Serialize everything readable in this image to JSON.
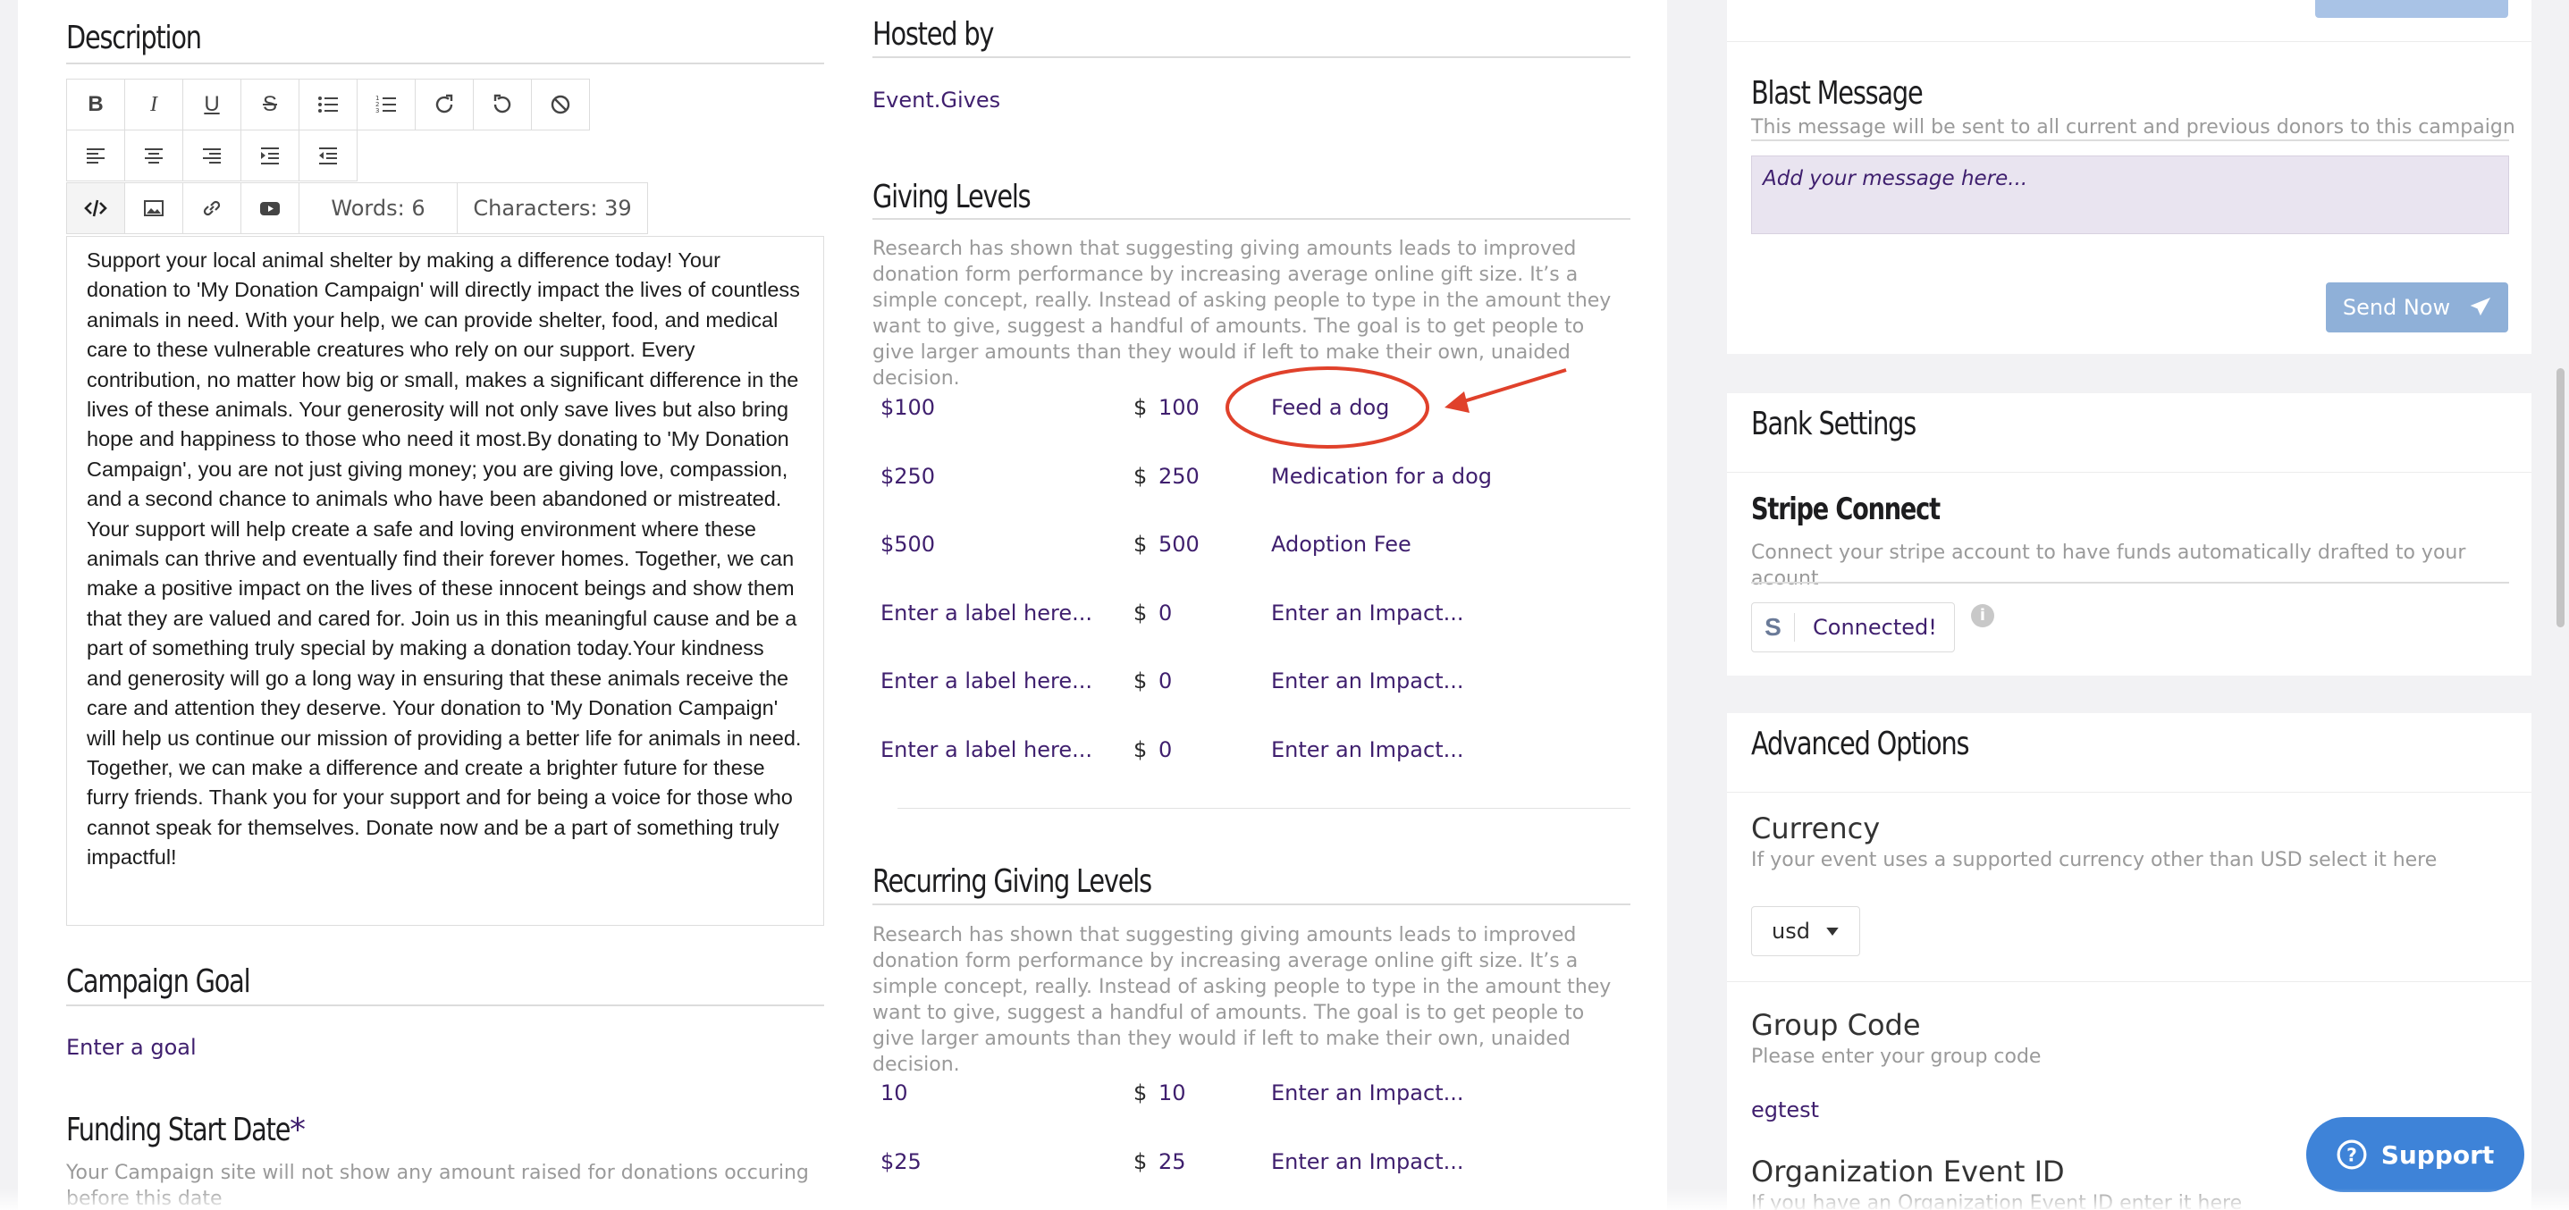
{
  "left": {
    "description_heading": "Description",
    "toolbar": {
      "bold": "B",
      "italic": "I",
      "underline": "U",
      "strike": "S",
      "words": "Words: 6",
      "characters": "Characters: 39"
    },
    "description_text": "Support your local animal shelter by making a difference today! Your donation to 'My Donation Campaign' will directly impact the lives of countless animals in need. With your help, we can provide shelter, food, and medical care to these vulnerable creatures who rely on our support. Every contribution, no matter how big or small, makes a significant difference in the lives of these animals. Your generosity will not only save lives but also bring hope and happiness to those who need it most.By donating to 'My Donation Campaign', you are not just giving money; you are giving love, compassion, and a second chance to animals who have been abandoned or mistreated. Your support will help create a safe and loving environment where these animals can thrive and eventually find their forever homes. Together, we can make a positive impact on the lives of these innocent beings and show them that they are valued and cared for. Join us in this meaningful cause and be a part of something truly special by making a donation today.Your kindness and generosity will go a long way in ensuring that these animals receive the care and attention they deserve. Your donation to 'My Donation Campaign' will help us continue our mission of providing a better life for animals in need. Together, we can make a difference and create a brighter future for these furry friends. Thank you for your support and for being a voice for those who cannot speak for themselves. Donate now and be a part of something truly impactful!",
    "campaign_goal_heading": "Campaign Goal",
    "campaign_goal_placeholder": "Enter a goal",
    "funding_start_heading": "Funding Start Date",
    "funding_start_required": "*",
    "funding_start_help": "Your Campaign site will not show any amount raised for donations occuring before this date"
  },
  "middle": {
    "hosted_by_heading": "Hosted by",
    "hosted_by_value": "Event.Gives",
    "giving_levels_heading": "Giving Levels",
    "giving_levels_help": "Research has shown that suggesting giving amounts leads to improved donation form performance by increasing average online gift size. It’s a simple concept, really. Instead of asking people to type in the amount they want to give, suggest a handful of amounts. The goal is to get people to give larger amounts than they would if left to make their own, unaided decision.",
    "giving_levels": [
      {
        "label": "$100",
        "currency": "$",
        "amount": "100",
        "impact": "Feed a dog"
      },
      {
        "label": "$250",
        "currency": "$",
        "amount": "250",
        "impact": "Medication for a dog"
      },
      {
        "label": "$500",
        "currency": "$",
        "amount": "500",
        "impact": "Adoption Fee"
      },
      {
        "label": "Enter a label here...",
        "currency": "$",
        "amount": "0",
        "impact": "Enter an Impact..."
      },
      {
        "label": "Enter a label here...",
        "currency": "$",
        "amount": "0",
        "impact": "Enter an Impact..."
      },
      {
        "label": "Enter a label here...",
        "currency": "$",
        "amount": "0",
        "impact": "Enter an Impact..."
      }
    ],
    "recurring_heading": "Recurring Giving Levels",
    "recurring_help": "Research has shown that suggesting giving amounts leads to improved donation form performance by increasing average online gift size. It’s a simple concept, really. Instead of asking people to type in the amount they want to give, suggest a handful of amounts. The goal is to get people to give larger amounts than they would if left to make their own, unaided decision.",
    "recurring_levels": [
      {
        "label": "10",
        "currency": "$",
        "amount": "10",
        "impact": "Enter an Impact..."
      },
      {
        "label": "$25",
        "currency": "$",
        "amount": "25",
        "impact": "Enter an Impact..."
      }
    ]
  },
  "right": {
    "blast_heading": "Blast Message",
    "blast_help": "This message will be sent to all current and previous donors to this campaign",
    "blast_placeholder": "Add your message here...",
    "send_now": "Send Now",
    "bank_heading": "Bank Settings",
    "stripe_heading": "Stripe Connect",
    "stripe_help": "Connect your stripe account to have funds automatically drafted to your acount",
    "stripe_badge_letter": "S",
    "stripe_status": "Connected!",
    "advanced_heading": "Advanced Options",
    "currency_heading": "Currency",
    "currency_help": "If your event uses a supported currency other than USD select it here",
    "currency_value": "usd",
    "group_code_heading": "Group Code",
    "group_code_help": "Please enter your group code",
    "group_code_value": "egtest",
    "org_event_heading": "Organization Event ID",
    "org_event_help": "If you have an Organization Event ID enter it here"
  },
  "support_label": "Support",
  "colors": {
    "accent_purple": "#3f1f6e",
    "annotation_red": "#e0412b",
    "support_blue": "#3e83d8",
    "send_blue": "#8fb0d8"
  }
}
